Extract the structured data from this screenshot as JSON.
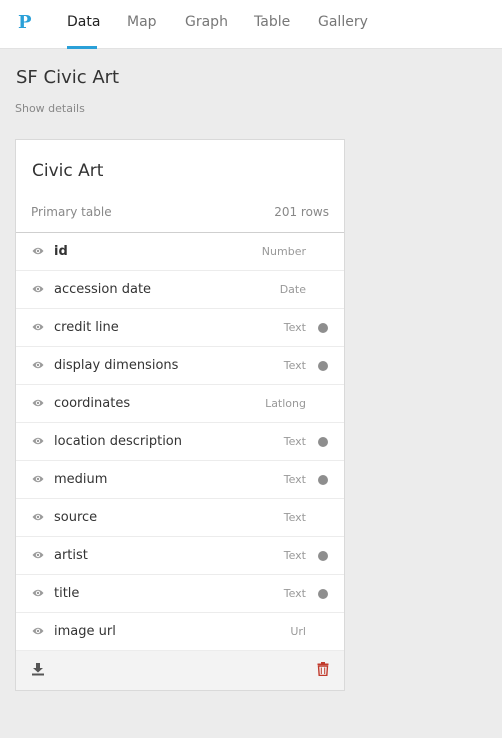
{
  "nav": {
    "logo": "P",
    "tabs": [
      {
        "label": "Data"
      },
      {
        "label": "Map"
      },
      {
        "label": "Graph"
      },
      {
        "label": "Table"
      },
      {
        "label": "Gallery"
      }
    ],
    "active_tab": "Data"
  },
  "page": {
    "title": "SF Civic Art",
    "show_details": "Show details"
  },
  "card": {
    "title": "Civic Art",
    "subtitle": "Primary table",
    "row_count": "201 rows",
    "fields": [
      {
        "name": "id",
        "type": "Number",
        "dot": false,
        "bold": true
      },
      {
        "name": "accession date",
        "type": "Date",
        "dot": false
      },
      {
        "name": "credit line",
        "type": "Text",
        "dot": true
      },
      {
        "name": "display dimensions",
        "type": "Text",
        "dot": true
      },
      {
        "name": "coordinates",
        "type": "Latlong",
        "dot": false
      },
      {
        "name": "location description",
        "type": "Text",
        "dot": true
      },
      {
        "name": "medium",
        "type": "Text",
        "dot": true
      },
      {
        "name": "source",
        "type": "Text",
        "dot": false
      },
      {
        "name": "artist",
        "type": "Text",
        "dot": true
      },
      {
        "name": "title",
        "type": "Text",
        "dot": true
      },
      {
        "name": "image url",
        "type": "Url",
        "dot": false
      }
    ]
  },
  "colors": {
    "accent": "#2aa0d8",
    "delete": "#c0392b",
    "dot": "#8e8e8e"
  },
  "icons": {
    "field_visibility": "eye-icon",
    "footer_left": "download-icon",
    "footer_right": "trash-icon"
  }
}
